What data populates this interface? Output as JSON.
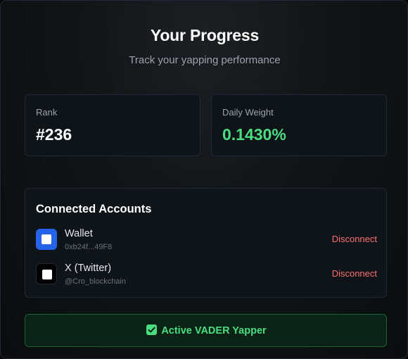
{
  "header": {
    "title": "Your Progress",
    "subtitle": "Track your yapping performance"
  },
  "stats": {
    "rank_label": "Rank",
    "rank_value": "#236",
    "weight_label": "Daily Weight",
    "weight_value": "0.1430%"
  },
  "accounts": {
    "title": "Connected Accounts",
    "items": [
      {
        "name": "Wallet",
        "detail": "0xb24f...49F8",
        "action": "Disconnect",
        "icon": "wallet-icon"
      },
      {
        "name": "X (Twitter)",
        "detail": "@Cro_blockchain",
        "action": "Disconnect",
        "icon": "x-twitter-icon"
      }
    ]
  },
  "status": {
    "label": "Active VADER Yapper",
    "icon": "checkbox-checked-icon"
  },
  "colors": {
    "accent_green": "#4ade80",
    "danger_red": "#f87171",
    "wallet_blue": "#2563eb"
  }
}
